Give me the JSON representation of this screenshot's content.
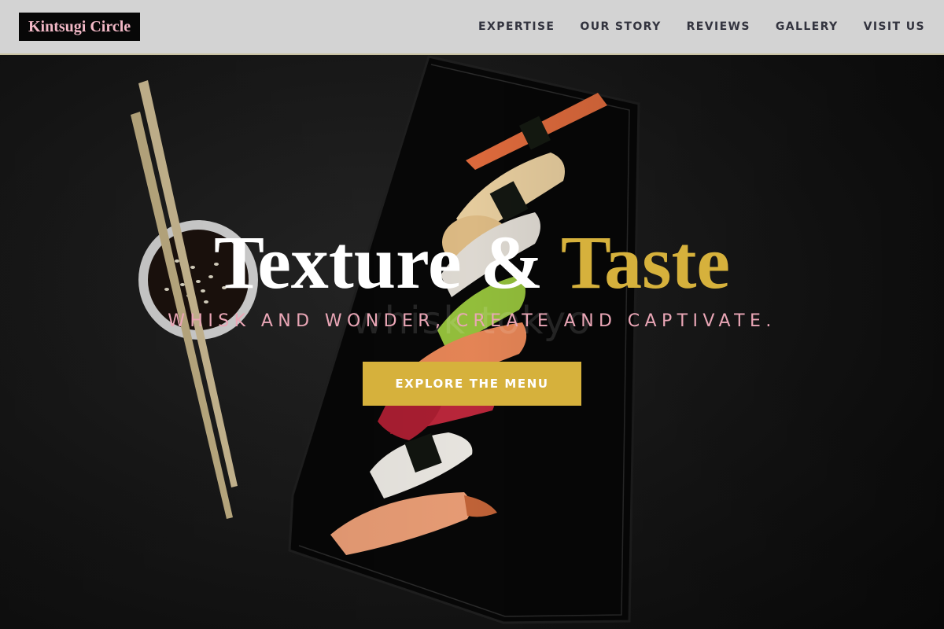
{
  "brand": {
    "name": "Kintsugi Circle"
  },
  "nav": {
    "items": [
      {
        "label": "EXPERTISE"
      },
      {
        "label": "OUR STORY"
      },
      {
        "label": "REVIEWS"
      },
      {
        "label": "GALLERY"
      },
      {
        "label": "VISIT US"
      }
    ]
  },
  "hero": {
    "title_main": "Texture & ",
    "title_accent": "Taste",
    "watermark": "whisk tokyo",
    "tagline": "WHISK AND WONDER, CREATE AND CAPTIVATE.",
    "cta_label": "EXPLORE THE MENU"
  },
  "colors": {
    "header_bg": "#d3d3d3",
    "logo_bg": "#070707",
    "logo_text": "#f2b8c6",
    "accent_gold": "#d6b13c",
    "tagline_pink": "#eaa6b6",
    "nav_text": "#33343f"
  }
}
